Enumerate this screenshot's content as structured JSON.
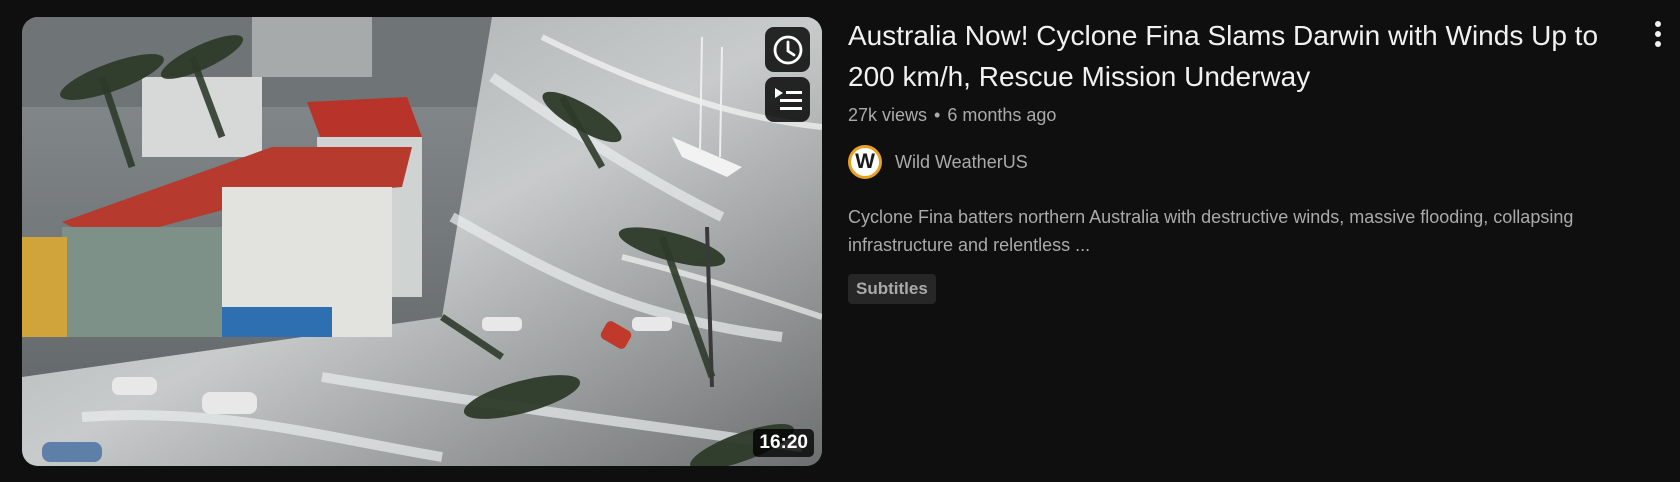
{
  "video": {
    "title": "Australia Now! Cyclone Fina Slams Darwin with Winds Up to 200 km/h, Rescue Mission Underway",
    "views": "27k views",
    "age": "6 months ago",
    "duration": "16:20",
    "description": "Cyclone Fina batters northern Australia with destructive winds, massive flooding, collapsing infrastructure and relentless ...",
    "badge": "Subtitles"
  },
  "channel": {
    "name": "Wild WeatherUS",
    "avatar_letter": "W"
  },
  "thumbnail_actions": [
    {
      "icon": "clock-icon",
      "label": "Watch later"
    },
    {
      "icon": "add-to-queue-icon",
      "label": "Add to queue"
    }
  ],
  "icons": {
    "menu": "more-vertical-icon"
  },
  "colors": {
    "background": "#0f0f0f",
    "title_text": "#f1f1f1",
    "secondary_text": "#aaaaaa",
    "badge_bg": "#272727",
    "avatar_ring": "#e8a022"
  }
}
